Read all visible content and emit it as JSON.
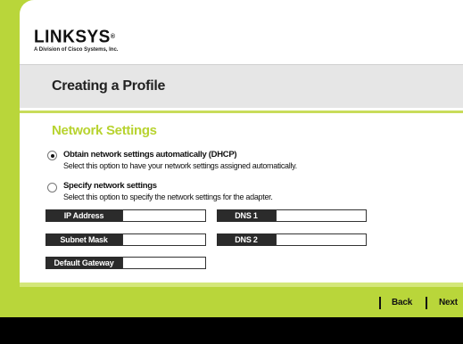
{
  "brand": {
    "name": "LINKSYS",
    "tagline": "A Division of Cisco Systems, Inc."
  },
  "page": {
    "title": "Creating a Profile",
    "section_title": "Network Settings"
  },
  "options": [
    {
      "label": "Obtain network settings automatically (DHCP)",
      "description": "Select this option to have your network settings assigned automatically.",
      "selected": true
    },
    {
      "label": "Specify network settings",
      "description": "Select this option to specify the network settings for the adapter.",
      "selected": false
    }
  ],
  "fields": {
    "ip_address": {
      "label": "IP Address",
      "value": ""
    },
    "subnet_mask": {
      "label": "Subnet Mask",
      "value": ""
    },
    "default_gateway": {
      "label": "Default Gateway",
      "value": ""
    },
    "dns1": {
      "label": "DNS 1",
      "value": ""
    },
    "dns2": {
      "label": "DNS 2",
      "value": ""
    }
  },
  "nav": {
    "back_label": "Back",
    "next_label": "Next"
  },
  "colors": {
    "accent_green": "#b9d63a",
    "section_green": "#b8d330",
    "field_label_bg": "#2b2b2b"
  }
}
